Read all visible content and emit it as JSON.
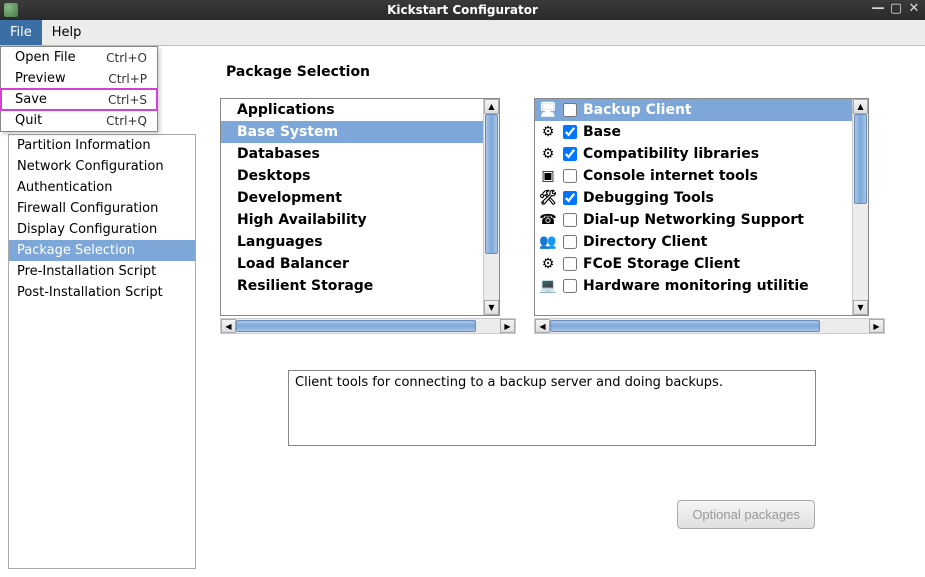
{
  "window": {
    "title": "Kickstart Configurator"
  },
  "menubar": {
    "items": [
      "File",
      "Help"
    ],
    "active_index": 0
  },
  "file_menu": {
    "items": [
      {
        "label": "Open File",
        "shortcut": "Ctrl+O"
      },
      {
        "label": "Preview",
        "shortcut": "Ctrl+P"
      },
      {
        "label": "Save",
        "shortcut": "Ctrl+S",
        "highlight": true
      },
      {
        "label": "Quit",
        "shortcut": "Ctrl+Q"
      }
    ]
  },
  "sidebar": {
    "items": [
      "Partition Information",
      "Network Configuration",
      "Authentication",
      "Firewall Configuration",
      "Display Configuration",
      "Package Selection",
      "Pre-Installation Script",
      "Post-Installation Script"
    ],
    "selected_index": 5
  },
  "content": {
    "heading": "Package Selection",
    "categories": [
      "Applications",
      "Base System",
      "Databases",
      "Desktops",
      "Development",
      "High Availability",
      "Languages",
      "Load Balancer",
      "Resilient Storage"
    ],
    "categories_selected_index": 1,
    "packages": [
      {
        "icon": "backup-icon",
        "glyph": "🖥",
        "checked": false,
        "label": "Backup Client",
        "selected": true
      },
      {
        "icon": "gear-icon",
        "glyph": "⚙",
        "checked": true,
        "label": "Base"
      },
      {
        "icon": "gear-icon",
        "glyph": "⚙",
        "checked": true,
        "label": "Compatibility libraries"
      },
      {
        "icon": "terminal-icon",
        "glyph": "▣",
        "checked": false,
        "label": "Console internet tools"
      },
      {
        "icon": "tools-icon",
        "glyph": "🛠",
        "checked": true,
        "label": "Debugging Tools"
      },
      {
        "icon": "phone-icon",
        "glyph": "☎",
        "checked": false,
        "label": "Dial-up Networking Support"
      },
      {
        "icon": "users-icon",
        "glyph": "👥",
        "checked": false,
        "label": "Directory Client"
      },
      {
        "icon": "gear-icon",
        "glyph": "⚙",
        "checked": false,
        "label": "FCoE Storage Client"
      },
      {
        "icon": "monitor-icon",
        "glyph": "💻",
        "checked": false,
        "label": "Hardware monitoring utilitie"
      }
    ],
    "description": "Client tools for connecting to a backup server and doing backups.",
    "optional_button": "Optional packages"
  }
}
